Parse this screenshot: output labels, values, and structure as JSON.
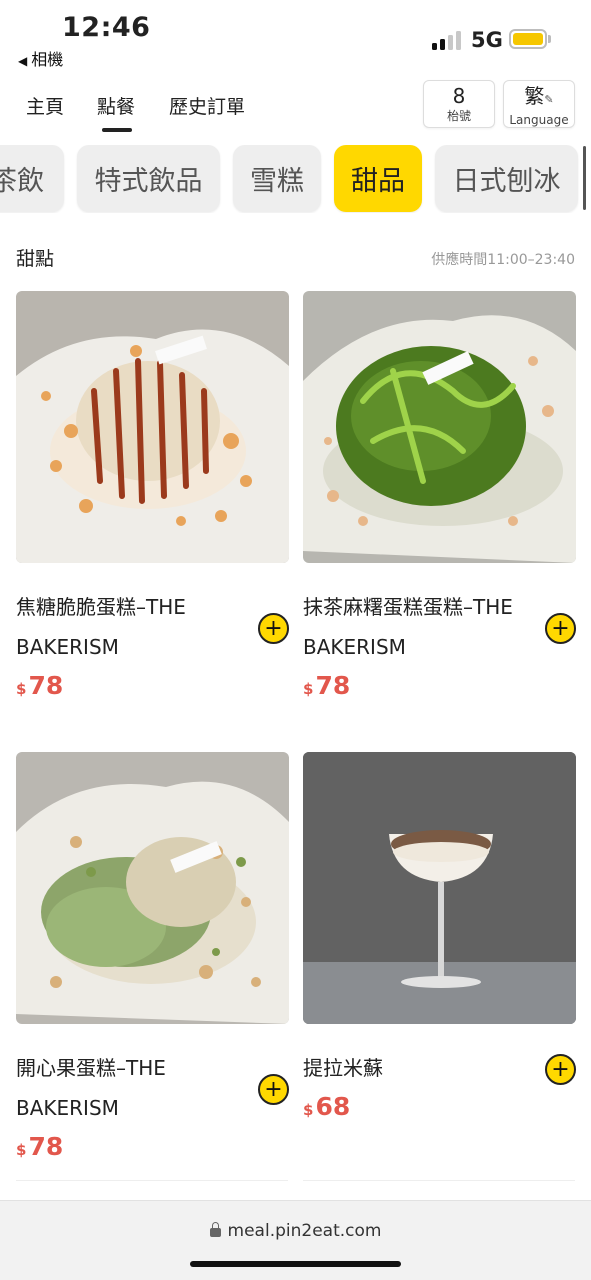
{
  "status_bar": {
    "time": "12:46",
    "back_app": "相機",
    "network": "5G",
    "battery_color": "#f6c700"
  },
  "nav": {
    "tabs": [
      {
        "label": "主頁",
        "active": false
      },
      {
        "label": "點餐",
        "active": true
      },
      {
        "label": "歷史訂單",
        "active": false
      }
    ],
    "table": {
      "number": "8",
      "label": "枱號"
    },
    "language": {
      "char": "繁",
      "label": "Language"
    }
  },
  "categories": [
    {
      "label": "茶飲",
      "active": false
    },
    {
      "label": "特式飲品",
      "active": false
    },
    {
      "label": "雪糕",
      "active": false
    },
    {
      "label": "甜品",
      "active": true
    },
    {
      "label": "日式刨冰",
      "active": false
    }
  ],
  "section": {
    "title": "甜點",
    "hours": "供應時間11:00–23:40"
  },
  "products": [
    {
      "name": "焦糖脆脆蛋糕–THE BAKERISM",
      "currency": "$",
      "price": "78",
      "image": "caramel-crunch-cake-photo"
    },
    {
      "name": "抹茶麻糬蛋糕蛋糕–THE BAKERISM",
      "currency": "$",
      "price": "78",
      "image": "matcha-mochi-cake-photo"
    },
    {
      "name": "開心果蛋糕–THE BAKERISM",
      "currency": "$",
      "price": "78",
      "image": "pistachio-cake-photo"
    },
    {
      "name": "提拉米蘇",
      "currency": "$",
      "price": "68",
      "image": "tiramisu-glass-photo"
    }
  ],
  "url_bar": {
    "url": "meal.pin2eat.com",
    "icon": "lock-icon"
  },
  "colors": {
    "accent": "#ffd800",
    "price": "#e2574c"
  }
}
